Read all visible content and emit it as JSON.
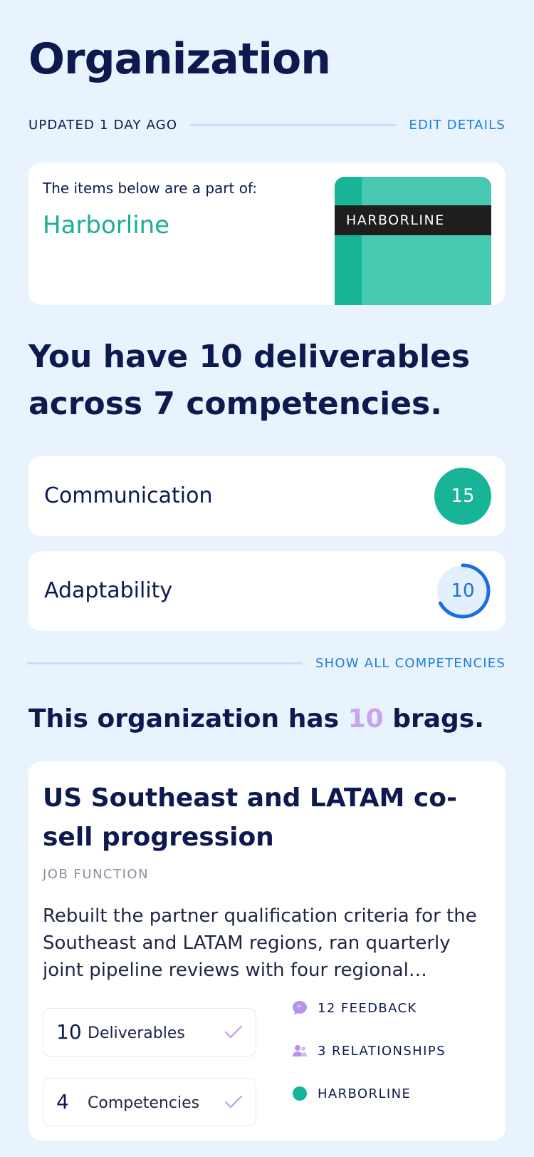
{
  "page": {
    "title": "Organization",
    "updated": "UPDATED 1 DAY AGO",
    "edit_label": "EDIT DETAILS"
  },
  "org_card": {
    "intro": "The items below are a part of:",
    "org_name": "Harborline",
    "logo_text": "HARBORLINE"
  },
  "summary": {
    "headline": "You have 10 deliverables across 7 competencies."
  },
  "competencies": [
    {
      "label": "Communication",
      "count": "15",
      "style": "full",
      "progress": 1.0
    },
    {
      "label": "Adaptability",
      "count": "10",
      "style": "ring",
      "progress": 0.67
    }
  ],
  "show_all_label": "SHOW ALL COMPETENCIES",
  "brags_headline": {
    "prefix": "This organization has ",
    "count": "10",
    "suffix": " brags."
  },
  "brag": {
    "title": "US Southeast and LATAM co-sell progression",
    "tag": "JOB FUNCTION",
    "description": "Rebuilt the partner qualification criteria for the Southeast and LATAM regions, ran quarterly joint pipeline reviews with four regional partners, and documented the co-sell playbook for the wider team.",
    "stats": [
      {
        "num": "10",
        "label": "Deliverables"
      },
      {
        "num": "4",
        "label": "Competencies"
      }
    ],
    "feedback": "12 FEEDBACK",
    "relationships": "3 RELATIONSHIPS",
    "org": "HARBORLINE"
  },
  "colors": {
    "background": "#e8f3fe",
    "navy": "#0e1a4f",
    "teal": "#17b497",
    "blue_link": "#1a7fe0",
    "lavender": "#c9a4ee"
  }
}
